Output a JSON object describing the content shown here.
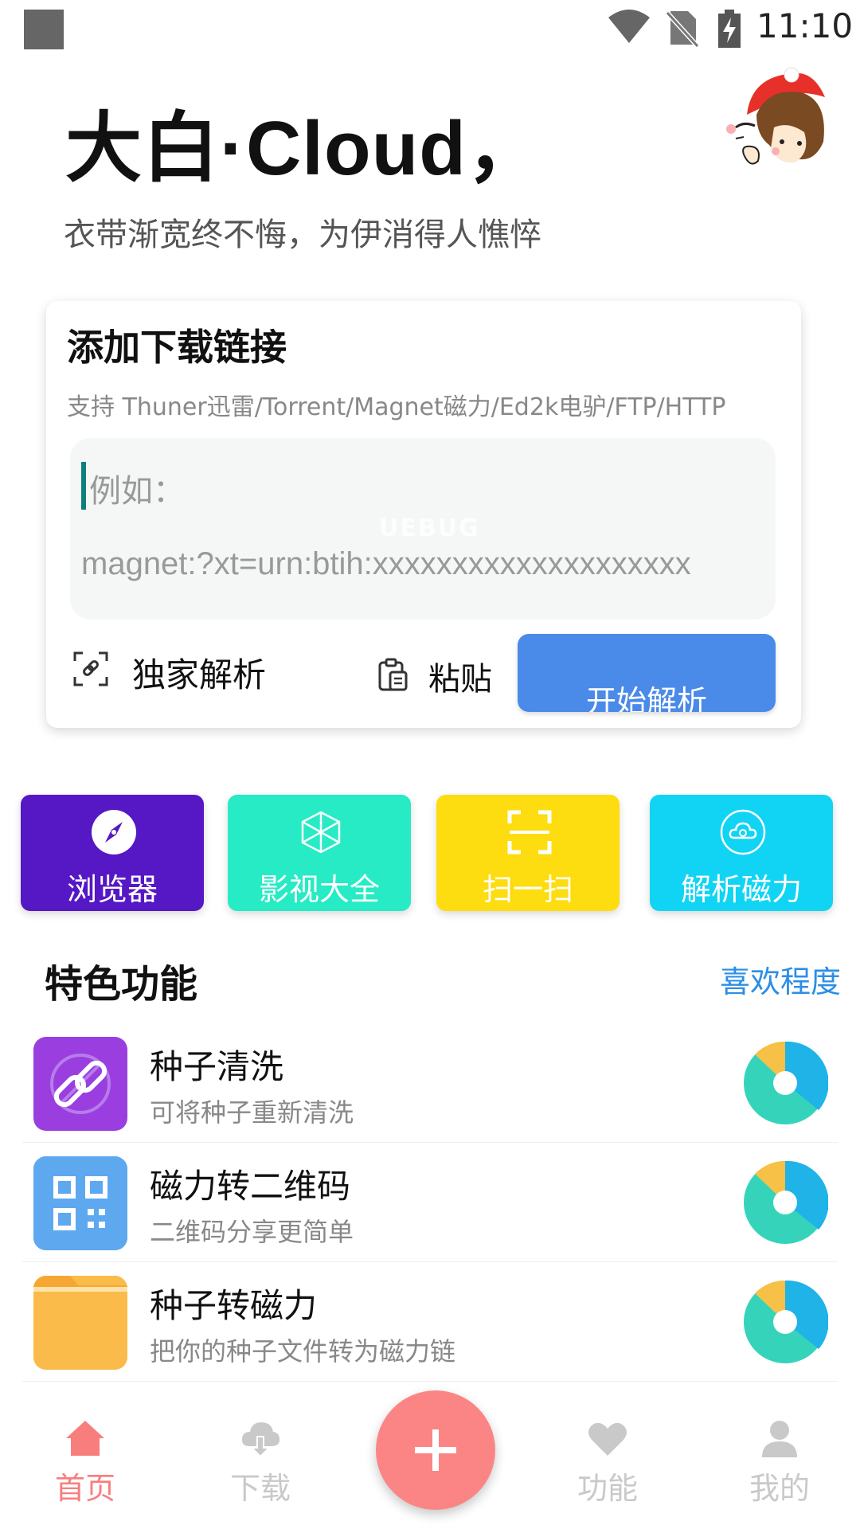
{
  "status_bar": {
    "time": "11:10"
  },
  "header": {
    "greeting": "大白·Cloud，",
    "subtitle": "衣带渐宽终不悔，为伊消得人憔悴"
  },
  "card": {
    "title": "添加下载链接",
    "support": "支持 Thuner迅雷/Torrent/Magnet磁力/Ed2k电驴/FTP/HTTP",
    "placeholder_line1": "例如：",
    "placeholder_line2": "magnet:?xt=urn:btih:xxxxxxxxxxxxxxxxxxxx",
    "watermark": "UEBUG",
    "parse_label": "独家解析",
    "paste_label": "粘贴",
    "start_label": "开始解析"
  },
  "tiles": [
    {
      "label": "浏览器",
      "color": "#5518c4",
      "icon": "compass-icon"
    },
    {
      "label": "影视大全",
      "color": "#27ebc4",
      "icon": "cube-icon"
    },
    {
      "label": "扫一扫",
      "color": "#fddc10",
      "icon": "scan-icon"
    },
    {
      "label": "解析磁力",
      "color": "#11d4f4",
      "icon": "cloud-icon"
    }
  ],
  "features": {
    "title": "特色功能",
    "link": "喜欢程度",
    "items": [
      {
        "title": "种子清洗",
        "desc": "可将种子重新清洗",
        "icon": "link-icon",
        "color": "#9a3ee0"
      },
      {
        "title": "磁力转二维码",
        "desc": "二维码分享更简单",
        "icon": "qrcode-icon",
        "color": "#3d8fe6"
      },
      {
        "title": "种子转磁力",
        "desc": "把你的种子文件转为磁力链",
        "icon": "folder-icon",
        "color": "#fbbb4a"
      }
    ]
  },
  "nav": {
    "items": [
      {
        "label": "首页",
        "icon": "home-icon",
        "active": true
      },
      {
        "label": "下载",
        "icon": "cloud-download-icon",
        "active": false
      },
      {
        "label": "功能",
        "icon": "heart-icon",
        "active": false
      },
      {
        "label": "我的",
        "icon": "user-icon",
        "active": false
      }
    ],
    "active_color": "#f87e7e",
    "inactive_color": "#c9c9c9",
    "fab_icon": "plus-icon"
  }
}
